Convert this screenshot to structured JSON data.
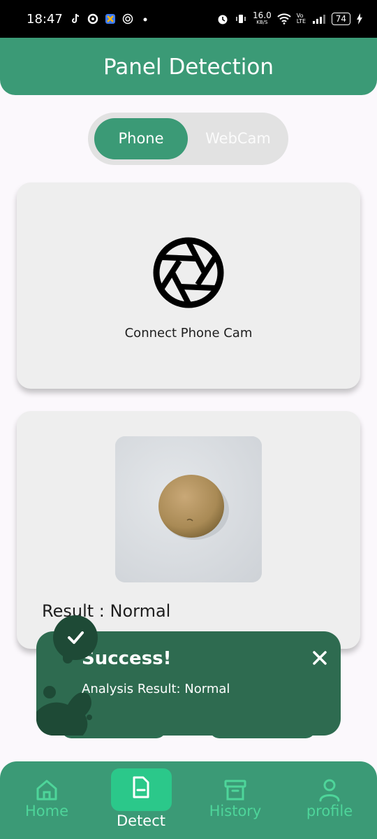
{
  "status_bar": {
    "time": "18:47",
    "network_speed": "16.0",
    "network_unit": "KB/S",
    "volte": "Vo LTE",
    "battery": "74"
  },
  "header": {
    "title": "Panel Detection"
  },
  "source_toggle": {
    "options": [
      "Phone",
      "WebCam"
    ],
    "selected": "Phone"
  },
  "camera_card": {
    "label": "Connect Phone Cam"
  },
  "result_card": {
    "result_text": "Result : Normal"
  },
  "toast": {
    "title": "Success!",
    "message": "Analysis Result: Normal",
    "background_color": "#2e6b50"
  },
  "bottom_nav": {
    "items": [
      {
        "label": "Home",
        "icon": "home-icon"
      },
      {
        "label": "Detect",
        "icon": "document-icon"
      },
      {
        "label": "History",
        "icon": "archive-icon"
      },
      {
        "label": "profile",
        "icon": "user-icon"
      }
    ],
    "active": "Detect"
  },
  "colors": {
    "accent": "#3b9a76",
    "nav_inactive": "#4ed59a",
    "active_tab": "#2bc88a"
  }
}
